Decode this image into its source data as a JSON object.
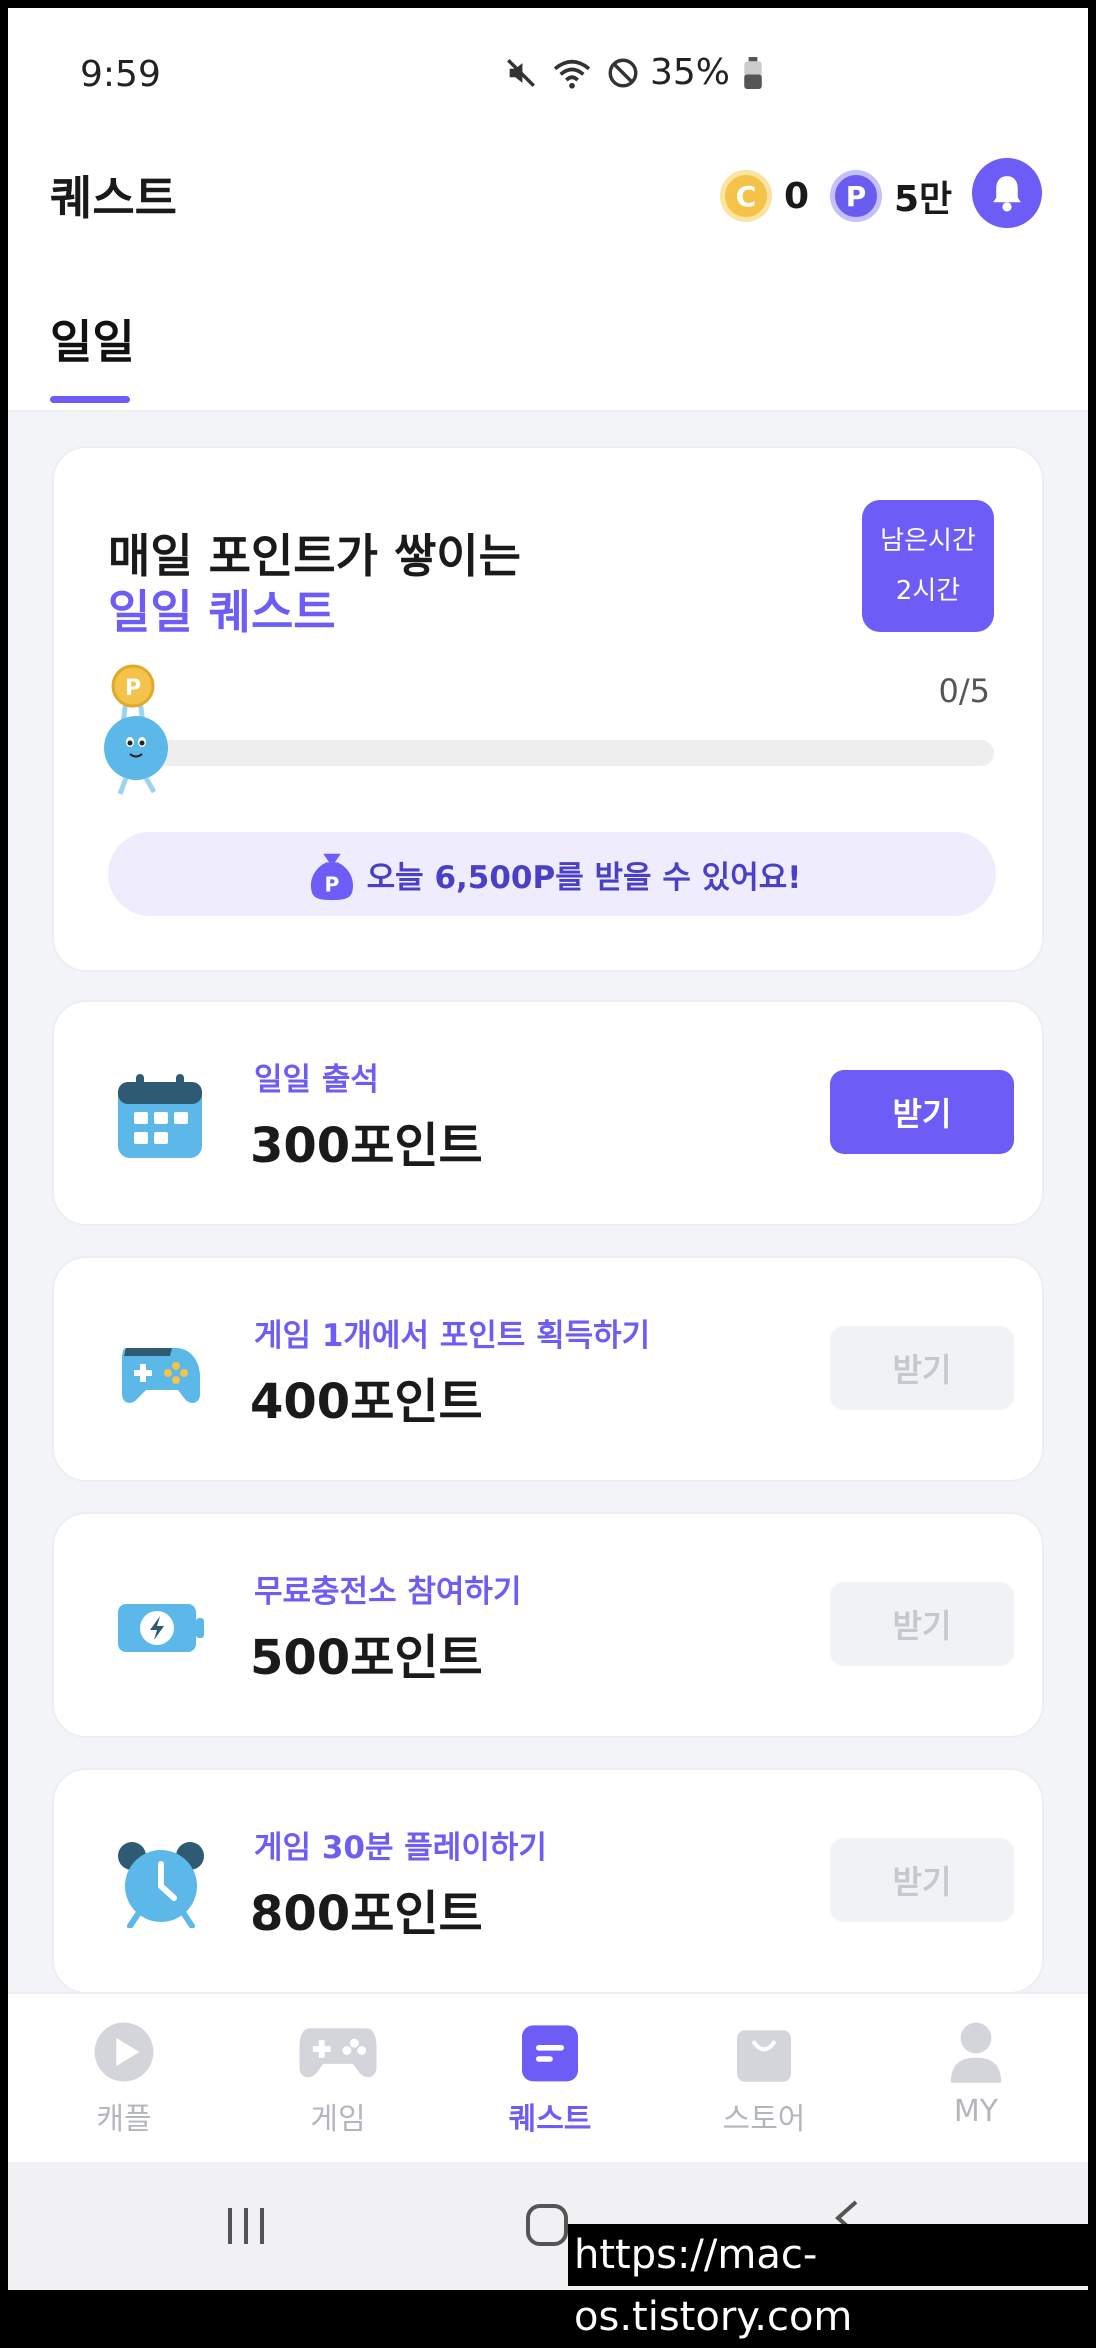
{
  "status_bar": {
    "time": "9:59",
    "battery": "35%",
    "icons": [
      "mute-icon",
      "wifi-icon",
      "do-not-disturb-icon",
      "battery-icon"
    ]
  },
  "header": {
    "title": "퀘스트",
    "coin_badge": "C",
    "coin_value": "0",
    "point_badge": "P",
    "point_value": "5만"
  },
  "tabs": [
    {
      "label": "일일",
      "active": true
    }
  ],
  "daily": {
    "title_line1": "매일 포인트가 쌓이는",
    "title_line2": "일일 퀘스트",
    "timer_label": "남은시간",
    "timer_value": "2시간",
    "progress_text": "0/5",
    "progress_current": 0,
    "progress_total": 5,
    "reward_badge": "P",
    "reward_banner": "오늘 6,500P를 받을 수 있어요!"
  },
  "quests": [
    {
      "icon": "calendar-icon",
      "title": "일일 출석",
      "points": "300포인트",
      "button": "받기",
      "enabled": true
    },
    {
      "icon": "gamepad-icon",
      "title": "게임 1개에서 포인트 획득하기",
      "points": "400포인트",
      "button": "받기",
      "enabled": false
    },
    {
      "icon": "battery-charge-icon",
      "title": "무료충전소 참여하기",
      "points": "500포인트",
      "button": "받기",
      "enabled": false
    },
    {
      "icon": "alarm-clock-icon",
      "title": "게임 30분 플레이하기",
      "points": "800포인트",
      "button": "받기",
      "enabled": false
    }
  ],
  "bottom_nav": [
    {
      "label": "캐플",
      "icon": "play-icon",
      "active": false
    },
    {
      "label": "게임",
      "icon": "gamepad-icon",
      "active": false
    },
    {
      "label": "퀘스트",
      "icon": "quest-icon",
      "active": true
    },
    {
      "label": "스토어",
      "icon": "shopping-bag-icon",
      "active": false
    },
    {
      "label": "MY",
      "icon": "user-icon",
      "active": false
    }
  ],
  "watermark": "https://mac-os.tistory.com",
  "colors": {
    "accent": "#6d5cf5",
    "coin": "#f5c24a",
    "background": "#f3f4f8",
    "disabled": "#f1f2f5"
  }
}
